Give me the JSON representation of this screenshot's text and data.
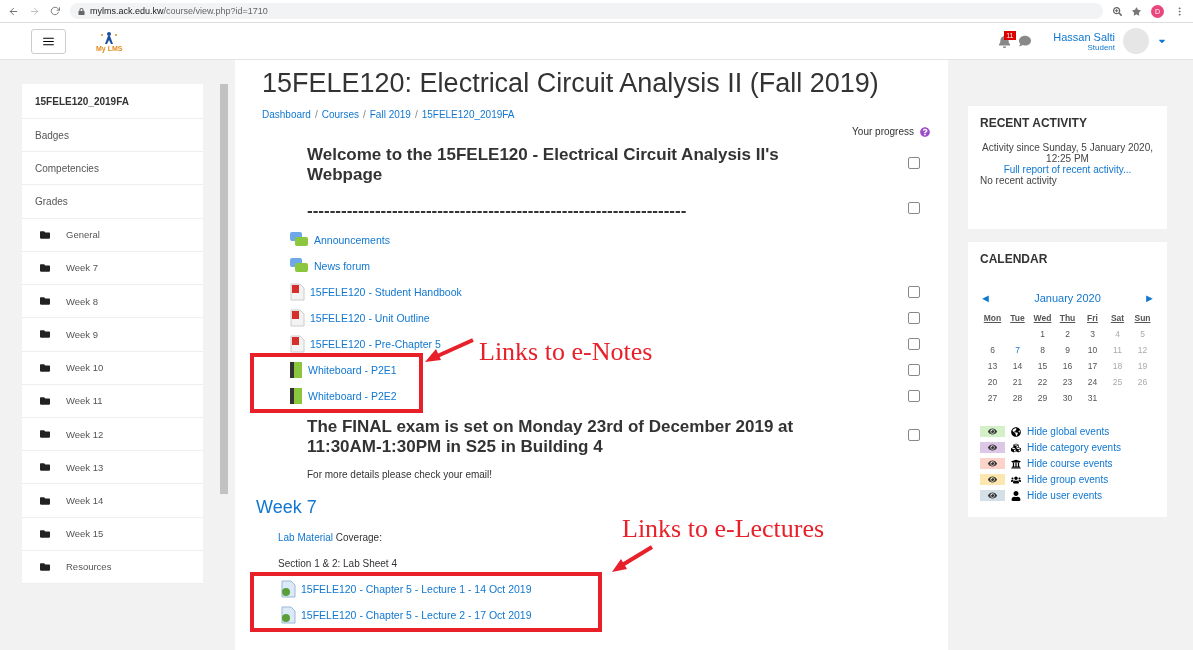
{
  "browser": {
    "url_host": "mylms.ack.edu.kw",
    "url_path": "/course/view.php?id=1710",
    "profile_initial": "D"
  },
  "navbar": {
    "logo_text": "My LMS",
    "notification_count": "11",
    "user_name": "Hassan Salti",
    "user_role": "Student"
  },
  "sidebar": {
    "course": "15FELE120_2019FA",
    "items": [
      {
        "label": "Badges",
        "kind": "link"
      },
      {
        "label": "Competencies",
        "kind": "link"
      },
      {
        "label": "Grades",
        "kind": "link"
      },
      {
        "label": "General",
        "kind": "section"
      },
      {
        "label": "Week 7",
        "kind": "section"
      },
      {
        "label": "Week 8",
        "kind": "section"
      },
      {
        "label": "Week 9",
        "kind": "section"
      },
      {
        "label": "Week 10",
        "kind": "section"
      },
      {
        "label": "Week 11",
        "kind": "section"
      },
      {
        "label": "Week 12",
        "kind": "section"
      },
      {
        "label": "Week 13",
        "kind": "section"
      },
      {
        "label": "Week 14",
        "kind": "section"
      },
      {
        "label": "Week 15",
        "kind": "section"
      },
      {
        "label": "Resources",
        "kind": "section"
      }
    ]
  },
  "page": {
    "title": "15FELE120: Electrical Circuit Analysis II (Fall 2019)",
    "breadcrumb": [
      {
        "kind": "link",
        "text": "Dashboard"
      },
      {
        "kind": "separator",
        "text": "/"
      },
      {
        "kind": "link",
        "text": "Courses"
      },
      {
        "kind": "separator",
        "text": "/"
      },
      {
        "kind": "link",
        "text": "Fall 2019"
      },
      {
        "kind": "separator",
        "text": "/"
      },
      {
        "kind": "link",
        "text": "15FELE120_2019FA"
      }
    ],
    "progress_label": "Your progress",
    "general_items": [
      {
        "kind": "heading",
        "text": "Welcome to the 15FELE120 - Electrical Circuit Analysis II's Webpage",
        "checked": false
      },
      {
        "kind": "heading",
        "text": "-------------------------------------------------------------------",
        "checked": false
      },
      {
        "kind": "forum",
        "text": "Announcements"
      },
      {
        "kind": "forum",
        "text": "News forum"
      },
      {
        "kind": "pdf",
        "text": "15FELE120 - Student Handbook",
        "checked": false
      },
      {
        "kind": "pdf",
        "text": "15FELE120 - Unit Outline",
        "checked": false
      },
      {
        "kind": "pdf",
        "text": "15FELE120 - Pre-Chapter 5",
        "checked": false
      },
      {
        "kind": "callout_side",
        "annotation": "Links to e-Notes",
        "items": [
          {
            "kind": "book",
            "text": "Whiteboard - P2E1",
            "checked": false
          },
          {
            "kind": "book",
            "text": "Whiteboard - P2E2",
            "checked": false
          }
        ]
      },
      {
        "kind": "heading",
        "text": "The FINAL exam is set on Monday 23rd of December 2019 at 11:30AM-1:30PM in S25 in Building 4",
        "checked": false
      },
      {
        "kind": "note",
        "text": "For more details please check your email!"
      }
    ],
    "week": {
      "title": "Week 7",
      "items": [
        {
          "kind": "mixed",
          "link": "Lab Material",
          "text": "Coverage:"
        },
        {
          "kind": "note",
          "text": "Section 1 & 2: Lab Sheet 4"
        },
        {
          "kind": "callout_above",
          "annotation": "Links to e-Lectures",
          "items": [
            {
              "kind": "url",
              "text": "15FELE120 - Chapter 5 - Lecture 1 - 14 Oct 2019"
            },
            {
              "kind": "url",
              "text": "15FELE120 - Chapter 5 - Lecture 2 - 17 Oct 2019"
            }
          ]
        }
      ]
    }
  },
  "recent_activity": {
    "title": "RECENT ACTIVITY",
    "since": "Activity since Sunday, 5 January 2020, 12:25 PM",
    "report_link": "Full report of recent activity...",
    "empty": "No recent activity"
  },
  "calendar": {
    "title": "CALENDAR",
    "prev": "◄",
    "month": "January 2020",
    "next": "►",
    "weekdays": [
      "Mon",
      "Tue",
      "Wed",
      "Thu",
      "Fri",
      "Sat",
      "Sun"
    ],
    "weeks": [
      {
        "days": [
          {
            "label": "1",
            "kind": "day"
          },
          {
            "label": "2",
            "kind": "day"
          },
          {
            "label": "3",
            "kind": "day"
          },
          {
            "label": "4",
            "kind": "weekend"
          },
          {
            "label": "5",
            "kind": "weekend"
          }
        ]
      },
      {
        "days": [
          {
            "label": "6",
            "kind": "day"
          },
          {
            "label": "7",
            "kind": "today"
          },
          {
            "label": "8",
            "kind": "day"
          },
          {
            "label": "9",
            "kind": "day"
          },
          {
            "label": "10",
            "kind": "day"
          },
          {
            "label": "11",
            "kind": "weekend"
          },
          {
            "label": "12",
            "kind": "weekend"
          }
        ]
      },
      {
        "days": [
          {
            "label": "13",
            "kind": "day"
          },
          {
            "label": "14",
            "kind": "day"
          },
          {
            "label": "15",
            "kind": "day"
          },
          {
            "label": "16",
            "kind": "day"
          },
          {
            "label": "17",
            "kind": "day"
          },
          {
            "label": "18",
            "kind": "weekend"
          },
          {
            "label": "19",
            "kind": "weekend"
          }
        ]
      },
      {
        "days": [
          {
            "label": "20",
            "kind": "day"
          },
          {
            "label": "21",
            "kind": "day"
          },
          {
            "label": "22",
            "kind": "day"
          },
          {
            "label": "23",
            "kind": "day"
          },
          {
            "label": "24",
            "kind": "day"
          },
          {
            "label": "25",
            "kind": "weekend"
          },
          {
            "label": "26",
            "kind": "weekend"
          }
        ]
      },
      {
        "days": [
          {
            "label": "27",
            "kind": "day"
          },
          {
            "label": "28",
            "kind": "day"
          },
          {
            "label": "29",
            "kind": "day"
          },
          {
            "label": "30",
            "kind": "day"
          },
          {
            "label": "31",
            "kind": "day"
          }
        ]
      }
    ],
    "filters": [
      {
        "kind": "global",
        "label": "Hide global events",
        "color": "#d4f0c8"
      },
      {
        "kind": "category",
        "label": "Hide category events",
        "color": "#dcc8e6"
      },
      {
        "kind": "course",
        "label": "Hide course events",
        "color": "#fbd3c8"
      },
      {
        "kind": "group",
        "label": "Hide group events",
        "color": "#fde7b0"
      },
      {
        "kind": "user",
        "label": "Hide user events",
        "color": "#d4dfe6"
      }
    ]
  }
}
